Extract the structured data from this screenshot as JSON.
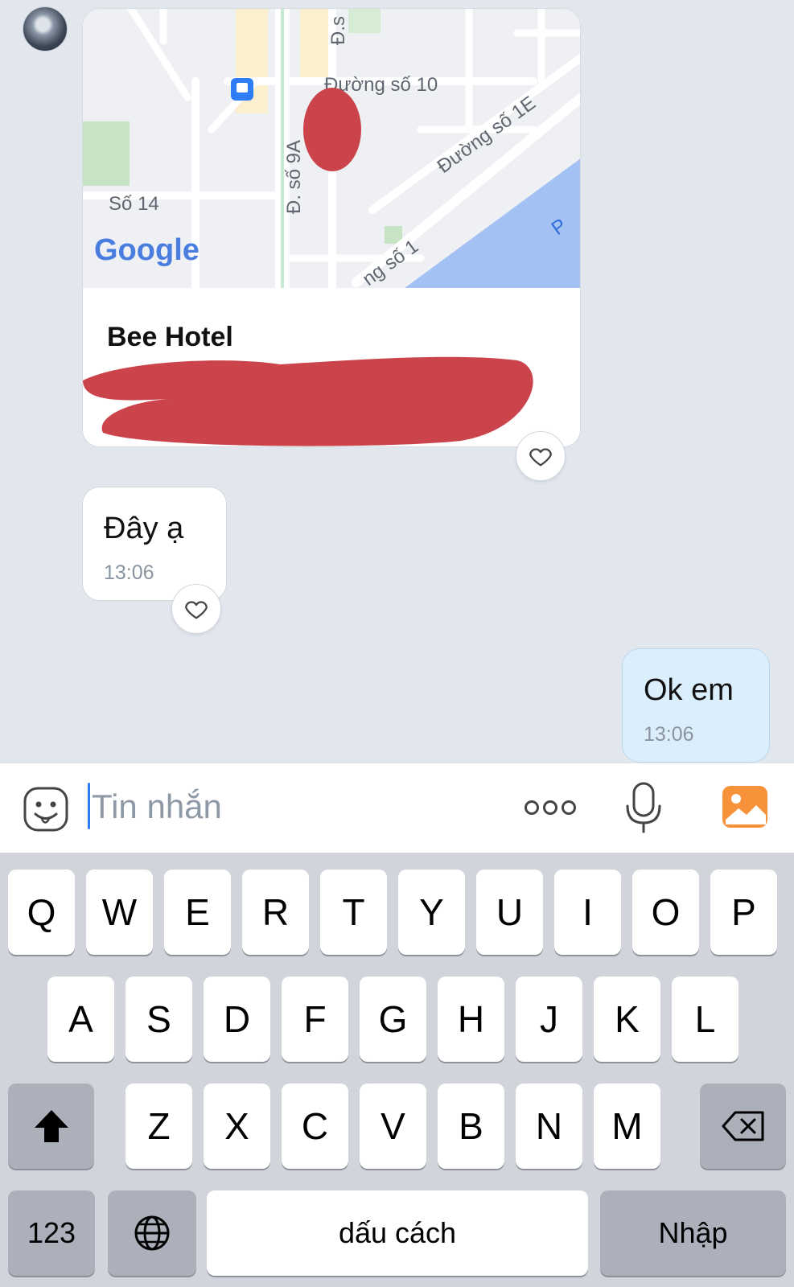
{
  "location_card": {
    "map_labels": [
      "Đường số 10",
      "Đường số 1E",
      "Đ. số 9A",
      "Số 14",
      "Đ.s",
      "ng số 1",
      "P"
    ],
    "map_brand": "Google",
    "title": "Bee Hotel",
    "address_visible": "n"
  },
  "messages": [
    {
      "direction": "incoming",
      "text": "Đây ạ",
      "time": "13:06"
    },
    {
      "direction": "outgoing",
      "text": "Ok em",
      "time": "13:06"
    }
  ],
  "composer": {
    "placeholder": "Tin nhắn",
    "more_icon": "more-dots-icon",
    "mic_icon": "microphone-icon",
    "image_icon": "image-gallery-icon",
    "emoji_icon": "emoji-icon",
    "image_color": "#f7913a"
  },
  "keyboard": {
    "row1": [
      "Q",
      "W",
      "E",
      "R",
      "T",
      "Y",
      "U",
      "I",
      "O",
      "P"
    ],
    "row2": [
      "A",
      "S",
      "D",
      "F",
      "G",
      "H",
      "J",
      "K",
      "L"
    ],
    "row3": [
      "Z",
      "X",
      "C",
      "V",
      "B",
      "N",
      "M"
    ],
    "numbers_key": "123",
    "space_key": "dấu cách",
    "return_key": "Nhập",
    "shift_icon": "shift-icon",
    "delete_icon": "backspace-icon",
    "globe_icon": "globe-icon"
  },
  "colors": {
    "chat_bg": "#e2e7ee",
    "outgoing_bubble": "#dbeefc",
    "accent_blue": "#2f7df6",
    "redaction": "#cc444b",
    "water": "#a4c1f4"
  }
}
